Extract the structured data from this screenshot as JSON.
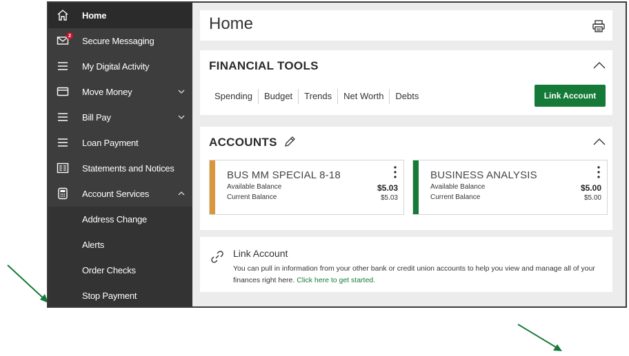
{
  "sidebar": {
    "items": [
      {
        "label": "Home",
        "icon": "home-icon",
        "active": true
      },
      {
        "label": "Secure Messaging",
        "icon": "mail-icon",
        "badge": "2"
      },
      {
        "label": "My Digital Activity",
        "icon": "menu-icon"
      },
      {
        "label": "Move Money",
        "icon": "card-icon",
        "chevron": "down"
      },
      {
        "label": "Bill Pay",
        "icon": "menu-icon",
        "chevron": "down"
      },
      {
        "label": "Loan Payment",
        "icon": "menu-icon"
      },
      {
        "label": "Statements and Notices",
        "icon": "statement-icon"
      },
      {
        "label": "Account Services",
        "icon": "calculator-icon",
        "chevron": "up"
      }
    ],
    "sub_items": [
      "Address Change",
      "Alerts",
      "Order Checks",
      "Stop Payment"
    ]
  },
  "page": {
    "title": "Home"
  },
  "financial_tools": {
    "title": "FINANCIAL TOOLS",
    "tools": [
      "Spending",
      "Budget",
      "Trends",
      "Net Worth",
      "Debts"
    ],
    "link_button": "Link Account"
  },
  "accounts": {
    "title": "ACCOUNTS",
    "available_label": "Available Balance",
    "current_label": "Current Balance",
    "items": [
      {
        "name": "BUS MM SPECIAL 8-18",
        "available": "$5.03",
        "current": "$5.03",
        "color": "#d9963a"
      },
      {
        "name": "BUSINESS ANALYSIS",
        "available": "$5.00",
        "current": "$5.00",
        "color": "#157a37"
      }
    ]
  },
  "link_account": {
    "title": "Link Account",
    "description": "You can pull in information from your other bank or credit union accounts to help you view and manage all of your finances right here.",
    "cta": "Click here to get started."
  },
  "colors": {
    "brand_green": "#157a37",
    "sidebar_bg": "#3d3d3d",
    "annotation_arrow": "#157a37"
  }
}
